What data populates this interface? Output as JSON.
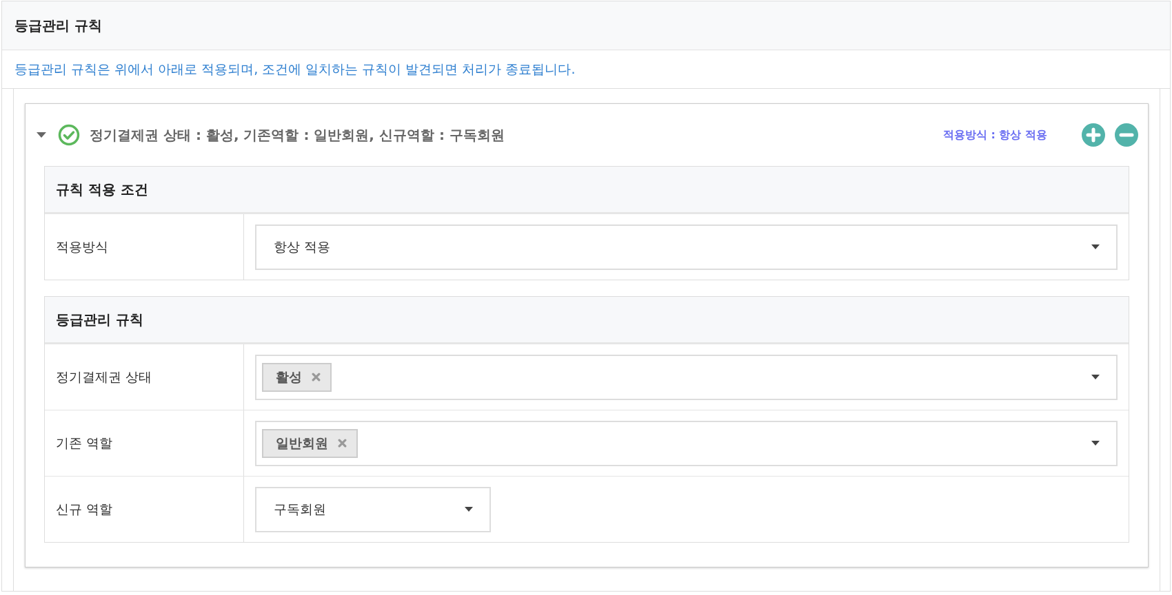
{
  "panel": {
    "title": "등급관리 규칙",
    "description": "등급관리 규칙은 위에서 아래로 적용되며, 조건에 일치하는 규칙이 발견되면 처리가 종료됩니다."
  },
  "rules": [
    {
      "expanded": true,
      "summary": "정기결제권 상태 : 활성, 기존역할 : 일반회원, 신규역할 : 구독회원",
      "apply_mode": "적용방식 : 항상 적용",
      "sections": [
        {
          "title": "규칙 적용 조건",
          "fields": [
            {
              "label": "적용방식",
              "kind": "select",
              "value": "항상 적용"
            }
          ]
        },
        {
          "title": "등급관리 규칙",
          "fields": [
            {
              "label": "정기결제권 상태",
              "kind": "tags",
              "tags": [
                "활성"
              ]
            },
            {
              "label": "기존 역할",
              "kind": "tags",
              "tags": [
                "일반회원"
              ]
            },
            {
              "label": "신규 역할",
              "kind": "dropdown",
              "value": "구독회원"
            }
          ]
        }
      ]
    }
  ]
}
